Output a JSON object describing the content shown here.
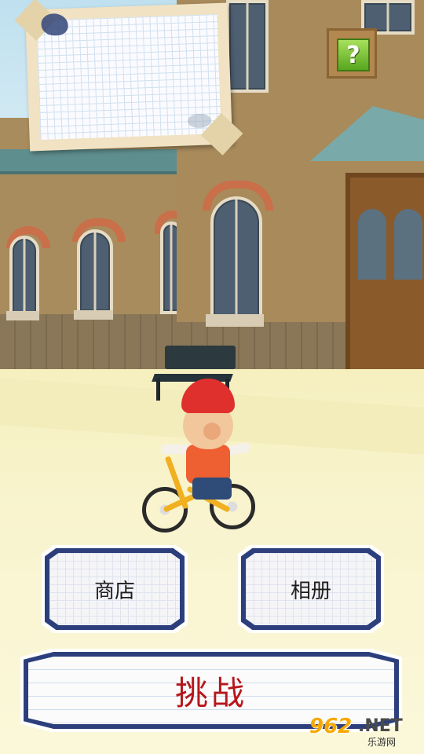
{
  "scene": {
    "name": "town-street-scene",
    "colors": {
      "helmet": "#e0302e",
      "bike": "#f0b020",
      "help": "#59a61f",
      "button_border": "#2c3f7c",
      "challenge_text": "#b5171c"
    }
  },
  "hud": {
    "help_label": "?",
    "help_icon": "question-mark-icon"
  },
  "menu": {
    "shop_label": "商店",
    "album_label": "相册",
    "challenge_label": "挑战"
  },
  "watermark": {
    "num": "962",
    "dot_net": ".NET",
    "sub": "乐游网"
  }
}
